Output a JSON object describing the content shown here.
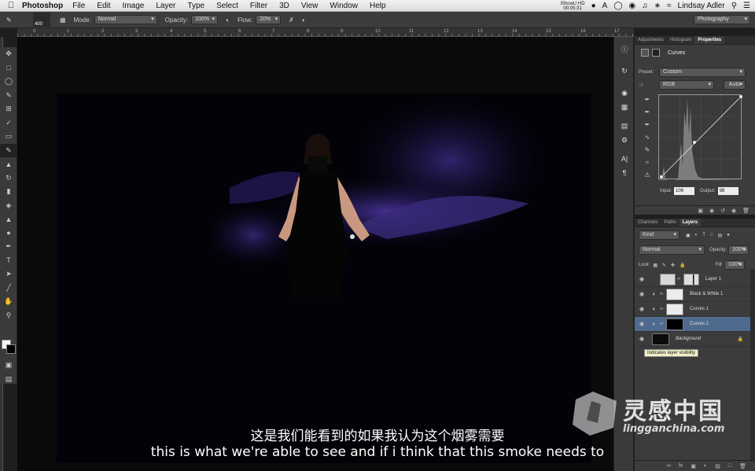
{
  "menubar": {
    "app": "Photoshop",
    "items": [
      "File",
      "Edit",
      "Image",
      "Layer",
      "Type",
      "Select",
      "Filter",
      "3D",
      "View",
      "Window",
      "Help"
    ],
    "recorder_line1": "iShowU HD",
    "recorder_line2": "00:05:31",
    "user": "Lindsay Adler"
  },
  "options": {
    "brush_size": "400",
    "mode_label": "Mode:",
    "mode_value": "Normal",
    "opacity_label": "Opacity:",
    "opacity_value": "100%",
    "flow_label": "Flow:",
    "flow_value": "20%",
    "workspace": "Photography"
  },
  "ruler": [
    "0",
    "1",
    "2",
    "3",
    "4",
    "5",
    "6",
    "7",
    "8",
    "9",
    "10",
    "11",
    "12",
    "13",
    "14",
    "15",
    "16",
    "17"
  ],
  "properties": {
    "tabs": [
      "Adjustments",
      "Histogram",
      "Properties"
    ],
    "title": "Curves",
    "preset_label": "Preset:",
    "preset_value": "Custom",
    "channel": "RGB",
    "auto_label": "Auto",
    "input_label": "Input:",
    "input_value": "106",
    "output_label": "Output:",
    "output_value": "98"
  },
  "layers_panel": {
    "tabs": [
      "Channels",
      "Paths",
      "Layers"
    ],
    "kind_label": "Kind",
    "blend_mode": "Normal",
    "opacity_label": "Opacity:",
    "opacity_value": "100%",
    "lock_label": "Lock:",
    "fill_label": "Fill:",
    "fill_value": "100%",
    "layers": [
      {
        "name": "Layer 1"
      },
      {
        "name": "Black & White 1"
      },
      {
        "name": "Curves 1"
      },
      {
        "name": "Curves 2"
      },
      {
        "name": "Background"
      }
    ],
    "tooltip": "Indicates layer visibility"
  },
  "subtitles": {
    "chinese": "这是我们能看到的如果我认为这个烟雾需要",
    "english": "this is what we're able to see and if i think that this smoke needs to"
  },
  "watermark": {
    "brand_cn": "灵感中国",
    "brand_en": "lingganchina.com"
  },
  "colors": {
    "selected_layer": "#4f6a8f",
    "smoke": "#3a2a7a"
  }
}
